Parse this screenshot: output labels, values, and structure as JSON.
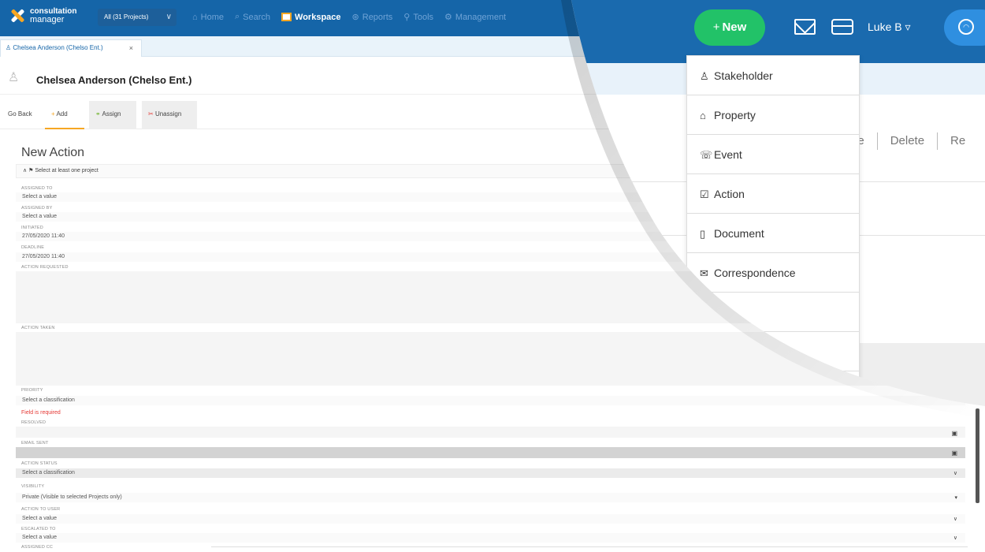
{
  "header": {
    "logo_line1": "consultation",
    "logo_line2": "manager",
    "project_select": "All (31 Projects)",
    "nav": [
      {
        "icon": "⌂",
        "label": "Home"
      },
      {
        "icon": "⌕",
        "label": "Search"
      },
      {
        "icon": "",
        "label": "Workspace"
      },
      {
        "icon": "⊛",
        "label": "Reports"
      },
      {
        "icon": "⚲",
        "label": "Tools"
      },
      {
        "icon": "⚙",
        "label": "Management"
      }
    ],
    "new_button": "New",
    "user": "Luke B"
  },
  "tab": {
    "label": "Chelsea Anderson (Chelso Ent.)",
    "close": "×"
  },
  "record": {
    "name": "Chelsea Anderson (Chelso Ent.)"
  },
  "toolbar": {
    "go_back": "Go Back",
    "add": "Add",
    "assign": "Assign",
    "unassign": "Unassign"
  },
  "form": {
    "title": "New Action",
    "project_notice": "Select at least one project",
    "fields": {
      "assigned_to": {
        "label": "ASSIGNED TO",
        "value": "Select a value"
      },
      "assigned_by": {
        "label": "ASSIGNED BY",
        "value": "Select a value"
      },
      "initiated": {
        "label": "INITIATED",
        "value": "27/05/2020 11:40"
      },
      "deadline": {
        "label": "DEADLINE",
        "value": "27/05/2020 11:40"
      },
      "action_requested": {
        "label": "ACTION REQUESTED"
      },
      "action_taken": {
        "label": "ACTION TAKEN"
      },
      "priority": {
        "label": "PRIORITY",
        "value": "Select a classification",
        "error": "Field is required"
      },
      "resolved": {
        "label": "RESOLVED"
      },
      "email_sent": {
        "label": "EMAIL SENT"
      },
      "action_status": {
        "label": "ACTION STATUS",
        "value": "Select a classification"
      },
      "visibility": {
        "label": "VISIBILITY",
        "value": "Private (Visible to selected Projects only)"
      },
      "action_to_user": {
        "label": "ACTION TO USER",
        "value": "Select a value"
      },
      "escalated_to": {
        "label": "ESCALATED TO",
        "value": "Select a value"
      },
      "assigned_cc": {
        "label": "ASSIGNED CC"
      }
    }
  },
  "record_actions": {
    "partial_left": "ne",
    "delete": "Delete",
    "partial_right": "Re"
  },
  "new_menu": [
    {
      "icon": "♙",
      "label": "Stakeholder"
    },
    {
      "icon": "⌂",
      "label": "Property"
    },
    {
      "icon": "☏",
      "label": "Event"
    },
    {
      "icon": "☑",
      "label": "Action"
    },
    {
      "icon": "▯",
      "label": "Document"
    },
    {
      "icon": "✉",
      "label": "Correspondence"
    }
  ],
  "colors": {
    "brand_blue": "#1565a8",
    "new_green": "#22c268",
    "accent_orange": "#f6a623",
    "error_red": "#e53935"
  }
}
